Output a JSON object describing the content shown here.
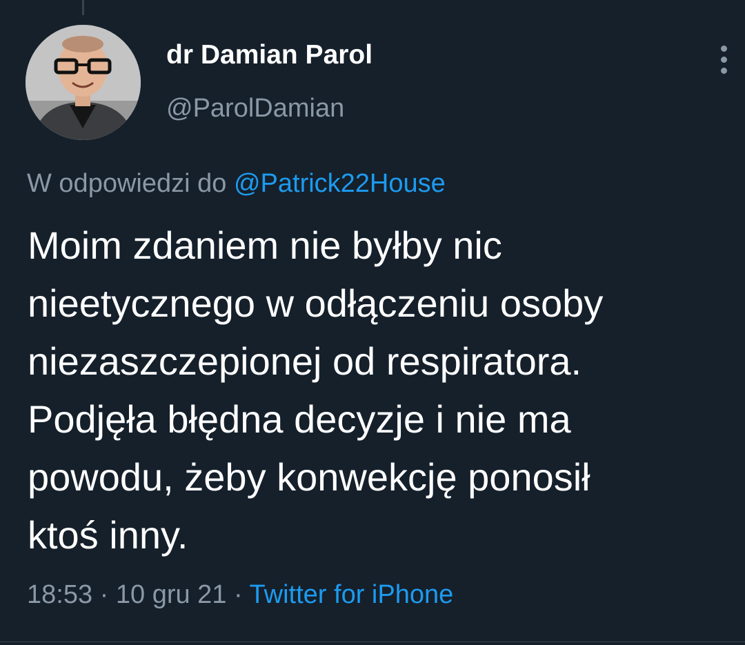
{
  "tweet": {
    "author": {
      "display_name": "dr Damian Parol",
      "handle": "@ParolDamian",
      "avatar_icon": "profile-photo"
    },
    "reply_prefix": "W odpowiedzi do",
    "reply_to": "@Patrick22House",
    "text": "Moim zdaniem nie byłby nic\nnieetycznego w odłączeniu osoby\nniezaszczepionej od respiratora.\nPodjęła błędna decyzje i nie ma\npowodu, żeby konwekcję ponosił\nktoś inny.",
    "time": "18:53",
    "separator": "·",
    "date": "10 gru 21",
    "source": "Twitter for iPhone",
    "more_icon": "more-vertical-icon"
  },
  "colors": {
    "background": "#15202b",
    "text_primary": "#ffffff",
    "text_secondary": "#8b98a5",
    "link": "#1d9bf0",
    "divider": "#38444d"
  }
}
